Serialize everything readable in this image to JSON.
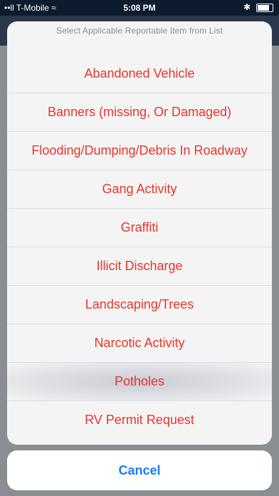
{
  "status_bar": {
    "carrier": "••ll T-Mobile ≈",
    "time": "5:08 PM",
    "bluetooth": "✱"
  },
  "action_sheet": {
    "title": "Select Applicable Reportable Item from List",
    "items": [
      {
        "label": "Abandoned Vehicle"
      },
      {
        "label": "Banners (missing, Or Damaged)"
      },
      {
        "label": "Flooding/Dumping/Debris In Roadway"
      },
      {
        "label": "Gang Activity"
      },
      {
        "label": "Graffiti"
      },
      {
        "label": "Illicit Discharge"
      },
      {
        "label": "Landscaping/Trees"
      },
      {
        "label": "Narcotic Activity"
      },
      {
        "label": "Potholes"
      },
      {
        "label": "RV Permit Request"
      }
    ],
    "cancel_label": "Cancel"
  },
  "colors": {
    "item_text": "#e8362d",
    "cancel_text": "#1a7cf5",
    "status_bar_bg": "#0c1b2e"
  }
}
